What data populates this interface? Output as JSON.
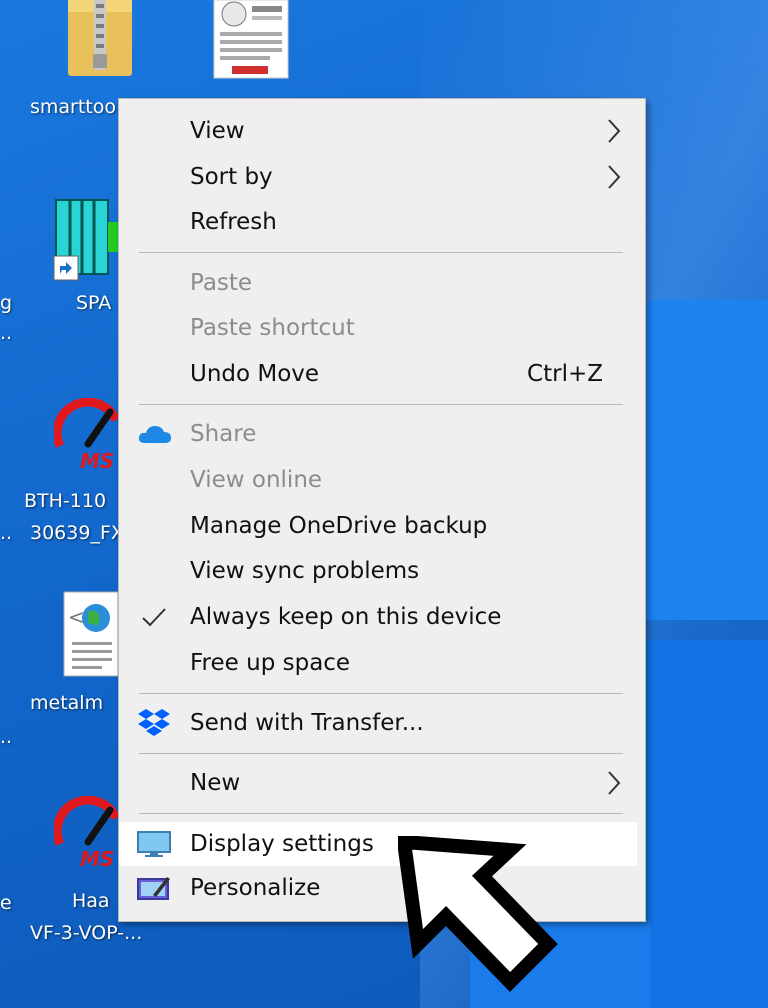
{
  "desktop": {
    "icons": [
      {
        "label": "smarttoo"
      },
      {
        "label": "SPA"
      },
      {
        "label": "BTH-110"
      },
      {
        "label": "30639_FX"
      },
      {
        "label": "metalm"
      },
      {
        "label": "Haa"
      },
      {
        "label": "VF-3-VOP-..."
      }
    ]
  },
  "menu": {
    "items": [
      {
        "label": "View"
      },
      {
        "label": "Sort by"
      },
      {
        "label": "Refresh"
      },
      {
        "label": "Paste"
      },
      {
        "label": "Paste shortcut"
      },
      {
        "label": "Undo Move",
        "shortcut": "Ctrl+Z"
      },
      {
        "label": "Share"
      },
      {
        "label": "View online"
      },
      {
        "label": "Manage OneDrive backup"
      },
      {
        "label": "View sync problems"
      },
      {
        "label": "Always keep on this device"
      },
      {
        "label": "Free up space"
      },
      {
        "label": "Send with Transfer..."
      },
      {
        "label": "New"
      },
      {
        "label": "Display settings"
      },
      {
        "label": "Personalize"
      }
    ]
  },
  "colors": {
    "desktop_blue": "#1570d6",
    "menu_bg": "#efefef",
    "disabled_text": "#8c8c8c",
    "onedrive_blue": "#1e88e5",
    "dropbox_blue": "#0061fe"
  }
}
